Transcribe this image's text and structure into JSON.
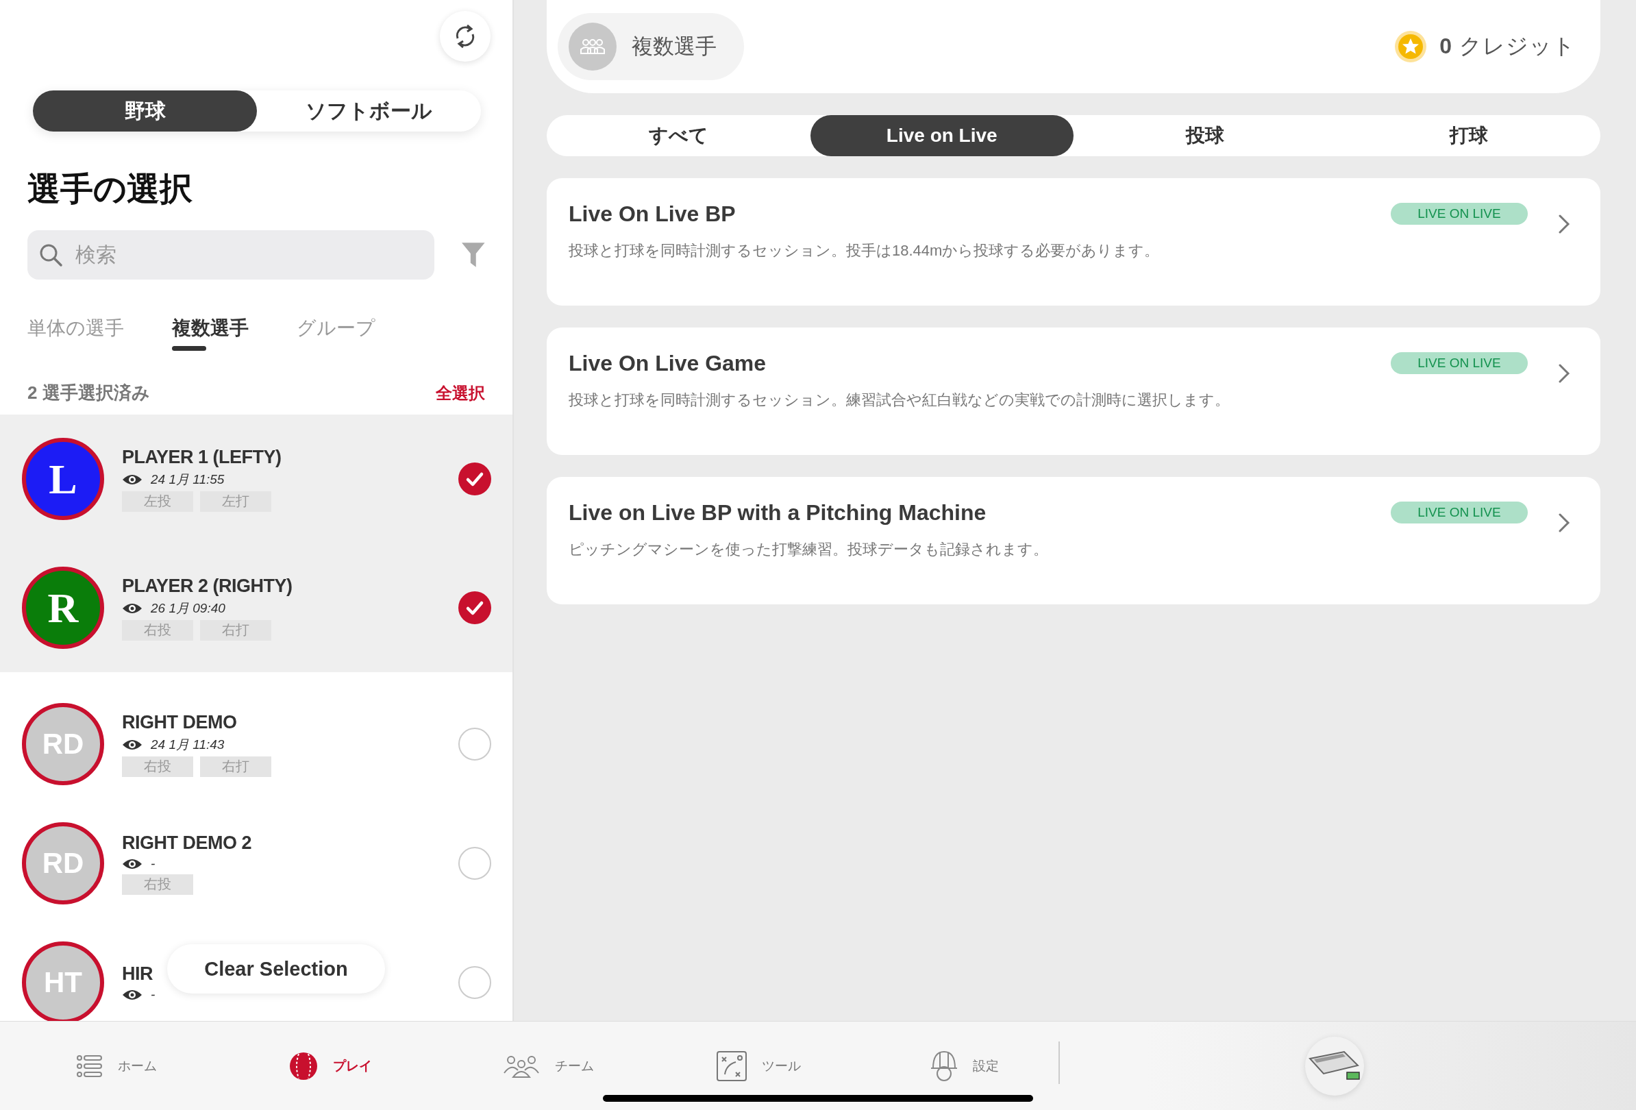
{
  "sport_toggle": [
    {
      "label": "野球",
      "selected": true
    },
    {
      "label": "ソフトボール",
      "selected": false
    }
  ],
  "title": "選手の選択",
  "search": {
    "placeholder": "検索"
  },
  "player_tabs": [
    {
      "label": "単体の選手",
      "selected": false
    },
    {
      "label": "複数選手",
      "selected": true
    },
    {
      "label": "グループ",
      "selected": false
    }
  ],
  "selection": {
    "count_label": "2 選手選択済み",
    "select_all": "全選択"
  },
  "players": [
    {
      "initials": "L",
      "kind": "logo",
      "color": "#1c1cf5",
      "name": "PLAYER 1 (LEFTY)",
      "last_seen": "24 1月 11:55",
      "tags": [
        "左投",
        "左打"
      ],
      "selected": true
    },
    {
      "initials": "R",
      "kind": "logo",
      "color": "#0a7d0a",
      "name": "PLAYER 2 (RIGHTY)",
      "last_seen": "26 1月 09:40",
      "tags": [
        "右投",
        "右打"
      ],
      "selected": true
    },
    {
      "initials": "RD",
      "kind": "initials",
      "color": "#c9c9c9",
      "name": "RIGHT DEMO",
      "last_seen": "24 1月 11:43",
      "tags": [
        "右投",
        "右打"
      ],
      "selected": false
    },
    {
      "initials": "RD",
      "kind": "initials",
      "color": "#c9c9c9",
      "name": "RIGHT DEMO 2",
      "last_seen": "-",
      "tags": [
        "右投"
      ],
      "selected": false
    },
    {
      "initials": "HT",
      "kind": "initials",
      "color": "#c9c9c9",
      "name": "HIR",
      "last_seen": "-",
      "selected": false
    }
  ],
  "clear_selection": "Clear Selection",
  "header": {
    "mode_label": "複数選手",
    "credits": "**0** クレジット"
  },
  "session_tabs": [
    {
      "label": "すべて",
      "selected": false
    },
    {
      "label": "Live on Live",
      "selected": true
    },
    {
      "label": "投球",
      "selected": false
    },
    {
      "label": "打球",
      "selected": false
    }
  ],
  "sessions": [
    {
      "title": "Live On Live BP",
      "description": "投球と打球を同時計測するセッション。投手は18.44mから投球する必要があります。",
      "badge": "LIVE ON LIVE"
    },
    {
      "title": "Live On Live Game",
      "description": "投球と打球を同時計測するセッション。練習試合や紅白戦などの実戦での計測時に選択します。",
      "badge": "LIVE ON LIVE"
    },
    {
      "title": "Live on Live BP with a Pitching Machine",
      "description": "ピッチングマシーンを使った打撃練習。投球データも記録されます。",
      "badge": "LIVE ON LIVE"
    }
  ],
  "nav": [
    {
      "label": "ホーム",
      "selected": false
    },
    {
      "label": "プレイ",
      "selected": true
    },
    {
      "label": "チーム",
      "selected": false
    },
    {
      "label": "ツール",
      "selected": false
    },
    {
      "label": "設定",
      "selected": false
    }
  ]
}
